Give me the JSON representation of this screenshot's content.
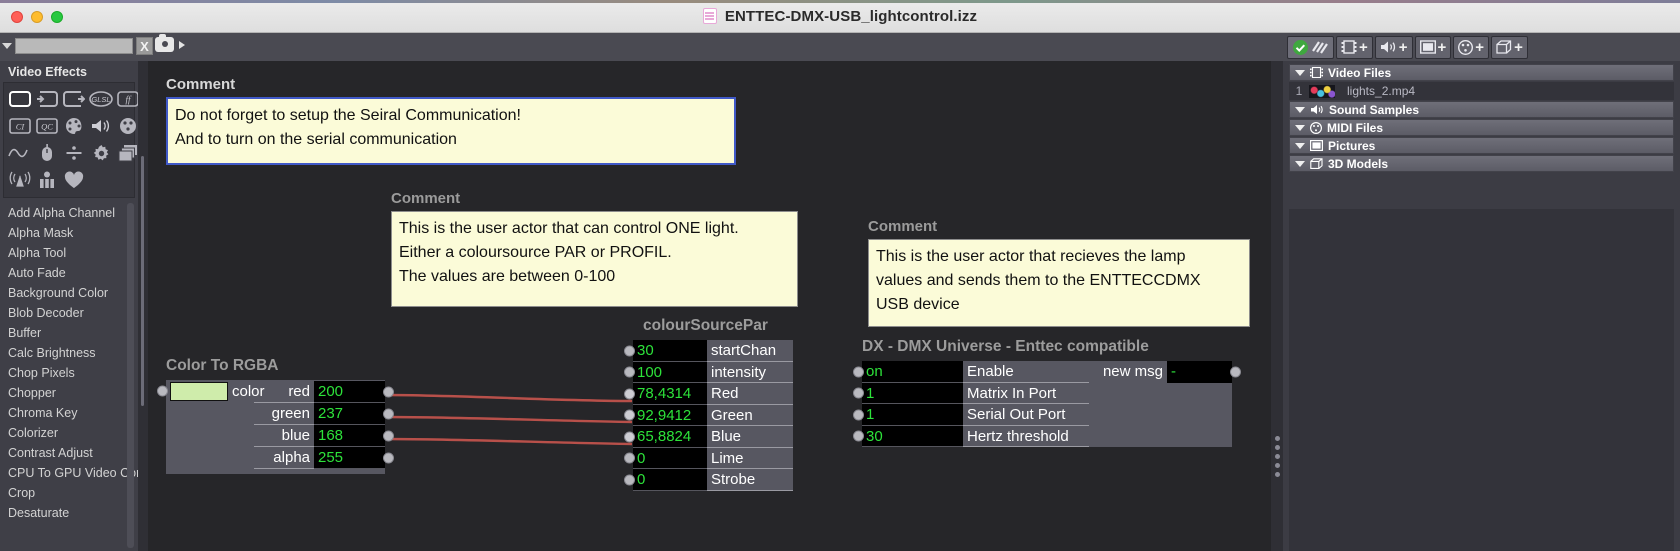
{
  "window": {
    "title": "ENTTEC-DMX-USB_lightcontrol.izz",
    "doc_icon": "film-document-icon",
    "traffic_lights": [
      "close-button",
      "minimize-button",
      "zoom-button"
    ]
  },
  "toolstrip": {
    "search_value": "",
    "search_placeholder": "",
    "clear_label": "X",
    "camera_icon": "camera-icon",
    "disclosure_icon": "chevron-down-icon",
    "play_icon": "play-triangle-icon"
  },
  "left_panel": {
    "title": "Video Effects",
    "icon_row_names": [
      "actor-frame-icon",
      "input-frame-icon",
      "output-frame-icon",
      "glsl-icon",
      "freeframe-icon",
      "core-image-icon",
      "quartz-composer-icon",
      "color-palette-icon",
      "audio-speaker-icon",
      "color-wheel-icon",
      "wave-icon",
      "mouse-icon",
      "divide-icon",
      "gear-icon",
      "layers-icon",
      "broadcast-icon",
      "user-actor-icon",
      "favorites-heart-icon"
    ],
    "icon_labels": {
      "glsl": "GLSL",
      "freeframe": "ff",
      "core_image": "CI",
      "quartz": "QC"
    },
    "effects": [
      "Add Alpha Channel",
      "Alpha Mask",
      "Alpha Tool",
      "Auto Fade",
      "Background Color",
      "Blob Decoder",
      "Buffer",
      "Calc Brightness",
      "Chop Pixels",
      "Chopper",
      "Chroma Key",
      "Colorizer",
      "Contrast Adjust",
      "CPU To GPU Video Cor",
      "Crop",
      "Desaturate"
    ]
  },
  "canvas": {
    "comments": [
      {
        "title": "Comment",
        "text": "Do not forget to setup the Seiral Communication!\nAnd to turn on the serial communication",
        "selected": true
      },
      {
        "title": "Comment",
        "text": "This is the user actor that can control ONE light.\nEither a coloursource PAR or PROFIL.\nThe values are between 0-100",
        "selected": false
      },
      {
        "title": "Comment",
        "text": "This is the user actor that recieves the lamp\nvalues and sends them to the ENTTECCDMX\nUSB device",
        "selected": false
      }
    ],
    "nodes": [
      {
        "id": "color-to-rgba",
        "title": "Color To RGBA",
        "color_swatch": "#cfecab",
        "color_label": "color",
        "outputs": [
          {
            "label": "red",
            "value": "200"
          },
          {
            "label": "green",
            "value": "237"
          },
          {
            "label": "blue",
            "value": "168"
          },
          {
            "label": "alpha",
            "value": "255"
          }
        ]
      },
      {
        "id": "colour-source-par",
        "title": "colourSourcePar",
        "inputs": [
          {
            "label": "startChan",
            "value": "30",
            "linked": false
          },
          {
            "label": "intensity",
            "value": "100",
            "linked": false
          },
          {
            "label": "Red",
            "value": "78,4314",
            "linked": true
          },
          {
            "label": "Green",
            "value": "92,9412",
            "linked": true
          },
          {
            "label": "Blue",
            "value": "65,8824",
            "linked": true
          },
          {
            "label": "Lime",
            "value": "0",
            "linked": false
          },
          {
            "label": "Strobe",
            "value": "0",
            "linked": false
          }
        ]
      },
      {
        "id": "dmx-universe",
        "title": "DX - DMX Universe - Enttec compatible",
        "inputs": [
          {
            "label": "Enable",
            "value": "on"
          },
          {
            "label": "Matrix In Port",
            "value": "1"
          },
          {
            "label": "Serial Out Port",
            "value": "1"
          },
          {
            "label": "Hertz threshold",
            "value": "30"
          }
        ],
        "outputs": [
          {
            "label": "new msg",
            "value": "-"
          }
        ]
      }
    ],
    "wire_color": "#b8504a"
  },
  "right_panel": {
    "toolbar_buttons": [
      {
        "name": "enable-media-toggle",
        "icon": "check-circle-icon",
        "label": ""
      },
      {
        "name": "add-video-file-button",
        "icon": "film-icon",
        "label": "+"
      },
      {
        "name": "add-sound-sample-button",
        "icon": "speaker-icon",
        "label": "+"
      },
      {
        "name": "add-picture-button",
        "icon": "picture-icon",
        "label": "+"
      },
      {
        "name": "add-midi-file-button",
        "icon": "midi-icon",
        "label": "+"
      },
      {
        "name": "add-3d-model-button",
        "icon": "cube-icon",
        "label": "+"
      }
    ],
    "groups": [
      {
        "label": "Video Files",
        "icon": "film-icon",
        "expanded": true,
        "items": [
          {
            "index": "1",
            "name": "lights_2.mp4",
            "thumbnail": "video-thumbnail"
          }
        ]
      },
      {
        "label": "Sound Samples",
        "icon": "speaker-icon",
        "expanded": true,
        "items": []
      },
      {
        "label": "MIDI Files",
        "icon": "midi-icon",
        "expanded": true,
        "items": []
      },
      {
        "label": "Pictures",
        "icon": "picture-icon",
        "expanded": true,
        "items": []
      },
      {
        "label": "3D Models",
        "icon": "cube-icon",
        "expanded": true,
        "items": []
      }
    ]
  },
  "colors": {
    "accent_selection": "#4059c8",
    "comment_bg": "#fbfbd8",
    "value_green": "#2de23a",
    "node_bg": "#575761",
    "canvas_bg": "#262629"
  }
}
